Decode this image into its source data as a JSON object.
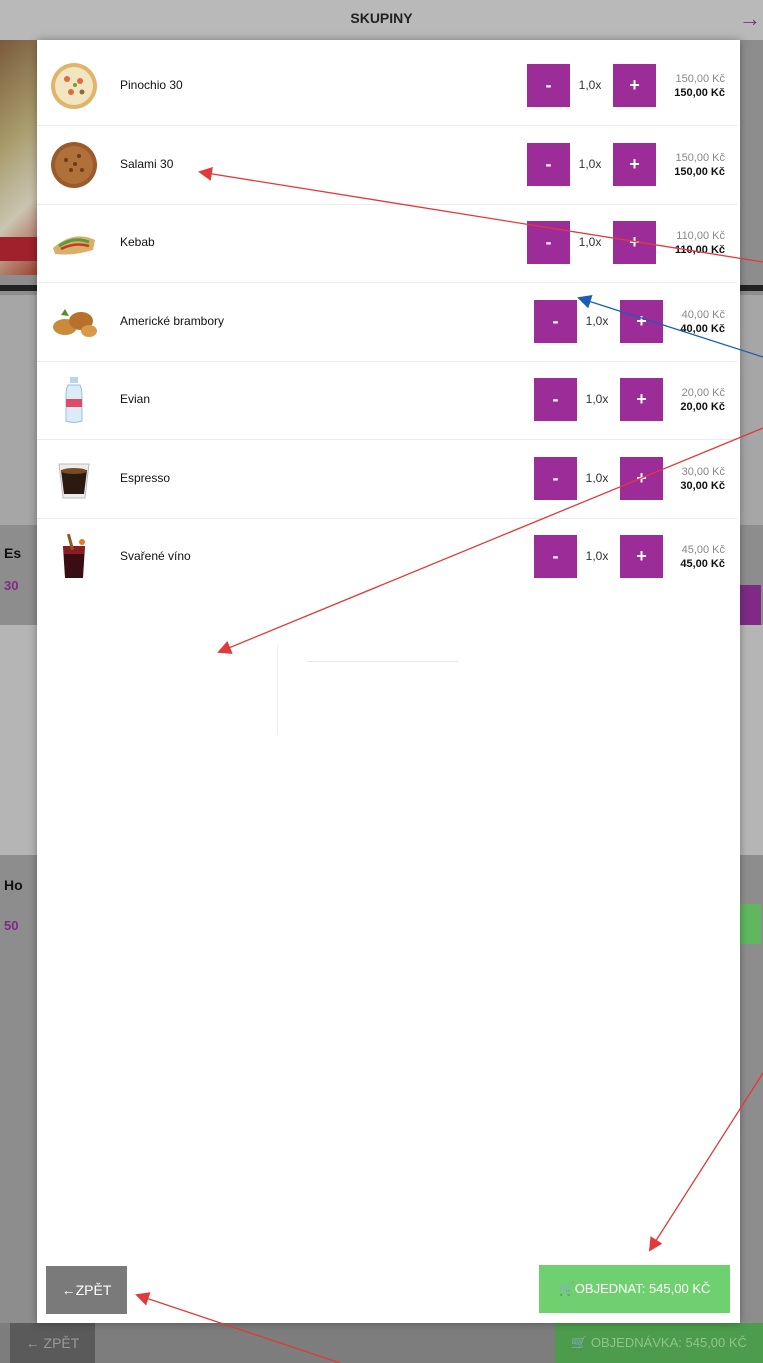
{
  "header": {
    "title": "SKUPINY",
    "exit_icon": "→"
  },
  "items": [
    {
      "name": "Pinochio 30",
      "qty": "1,0x",
      "unit_price": "150,00 Kč",
      "total_price": "150,00 Kč",
      "icon": "pizza-icon"
    },
    {
      "name": "Salami 30",
      "qty": "1,0x",
      "unit_price": "150,00 Kč",
      "total_price": "150,00 Kč",
      "icon": "pizza-icon"
    },
    {
      "name": "Kebab",
      "qty": "1,0x",
      "unit_price": "110,00 Kč",
      "total_price": "110,00 Kč",
      "icon": "kebab-icon"
    },
    {
      "name": "Americké brambory",
      "qty": "1,0x",
      "unit_price": "40,00 Kč",
      "total_price": "40,00 Kč",
      "icon": "potatoes-icon"
    },
    {
      "name": "Evian",
      "qty": "1,0x",
      "unit_price": "20,00 Kč",
      "total_price": "20,00 Kč",
      "icon": "bottle-icon"
    },
    {
      "name": "Espresso",
      "qty": "1,0x",
      "unit_price": "30,00 Kč",
      "total_price": "30,00 Kč",
      "icon": "coffee-icon"
    },
    {
      "name": "Svařené víno",
      "qty": "1,0x",
      "unit_price": "45,00 Kč",
      "total_price": "45,00 Kč",
      "icon": "mulled-wine-icon"
    }
  ],
  "buttons": {
    "minus": "-",
    "plus": "+",
    "back": "←ZPĚT",
    "order": "OBJEDNAT: 545,00 KČ",
    "order_icon": "🛒"
  },
  "background": {
    "card1_title": "Es",
    "card1_price": "30",
    "card2_title": "Ho",
    "card2_price": "50",
    "back": "← ZPĚT",
    "order": "🛒 OBJEDNÁVKA: 545,00 KČ"
  },
  "colors": {
    "accent": "#9b2c98",
    "order_green": "#6fd06f",
    "back_grey": "#7a7a7a",
    "annotation_red": "#e03a3a",
    "annotation_blue": "#1a5fb4"
  }
}
